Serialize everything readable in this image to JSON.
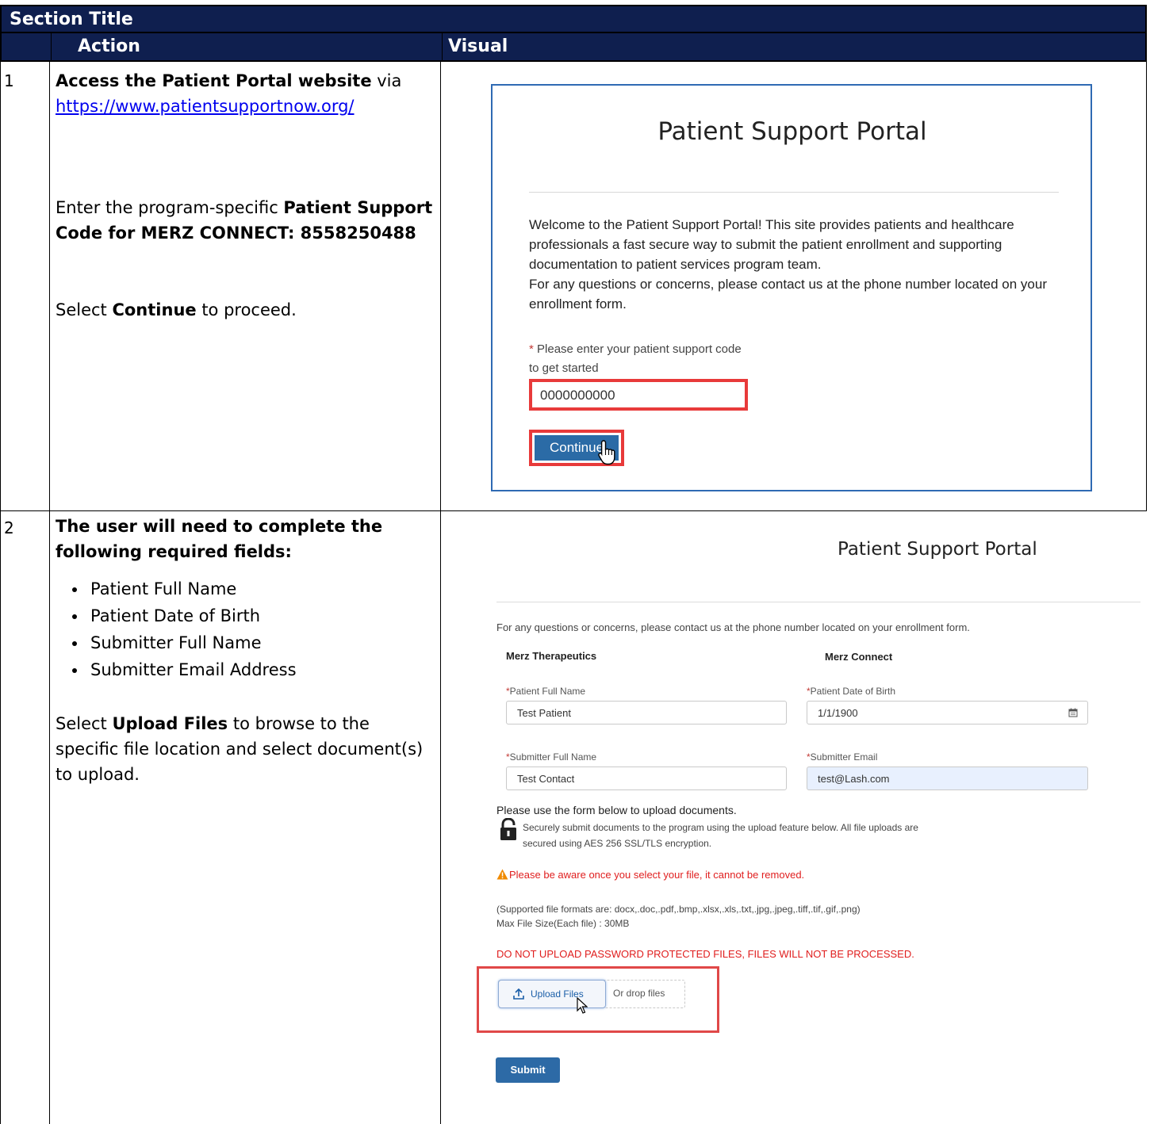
{
  "section_title": "Section Title",
  "columns": {
    "action": "Action",
    "visual": "Visual"
  },
  "row1": {
    "number": "1",
    "lead_bold": "Access the Patient Portal website",
    "lead_rest": " via",
    "url": "https://www.patientsupportnow.org/",
    "enter_text": "Enter the program-specific ",
    "code_bold": "Patient Support Code for MERZ CONNECT: 8558250488",
    "select_text": "Select ",
    "continue_bold": "Continue",
    "select_rest": " to proceed.",
    "screenshot": {
      "portal_title": "Patient Support Portal",
      "welcome": "Welcome to the Patient Support Portal! This site provides patients and healthcare professionals a fast secure way to submit the patient enrollment and supporting documentation to patient services program team.",
      "contact": "For any questions or concerns, please contact us at the phone number located on your enrollment form.",
      "code_label": "Please enter your patient support code to get started",
      "code_value": "0000000000",
      "continue_label": "Continue"
    }
  },
  "row2": {
    "number": "2",
    "intro_bold": "The user will need to complete the following required fields:",
    "fields": [
      "Patient Full Name",
      "Patient Date of Birth",
      "Submitter Full Name",
      "Submitter Email Address"
    ],
    "select_text": "Select ",
    "upload_bold": "Upload Files",
    "select_rest": " to browse to the specific file location and select document(s) to upload.",
    "screenshot": {
      "portal_title": "Patient Support Portal",
      "info": "For any questions or concerns, please contact us at the phone number located on your enrollment form.",
      "org_left": "Merz Therapeutics",
      "org_right": "Merz Connect",
      "patient_name_label": "Patient Full Name",
      "patient_name_value": "Test Patient",
      "dob_label": "Patient Date of Birth",
      "dob_value": "1/1/1900",
      "submitter_name_label": "Submitter Full Name",
      "submitter_name_value": "Test Contact",
      "submitter_email_label": "Submitter Email",
      "submitter_email_value": "test@Lash.com",
      "upload_heading": "Please use the form below to upload documents.",
      "secure_text": "Securely submit documents to the program using the upload feature below. All file uploads are secured using AES 256 SSL/TLS encryption.",
      "warning": "Please be aware once you select your file, it cannot be removed.",
      "formats": "(Supported file formats are: docx,.doc,.pdf,.bmp,.xlsx,.xls,.txt,.jpg,.jpeg,.tiff,.tif,.gif,.png)",
      "max_size": "Max File Size(Each file) : 30MB",
      "no_password": "DO NOT UPLOAD PASSWORD PROTECTED FILES, FILES WILL NOT BE PROCESSED.",
      "upload_label": "Upload Files",
      "drop_label": "Or drop files",
      "submit_label": "Submit"
    }
  },
  "colors": {
    "header_bg": "#0f1f4f",
    "link": "#0000ee",
    "highlight_red": "#e83a3a",
    "button_blue": "#2b6ba6"
  }
}
